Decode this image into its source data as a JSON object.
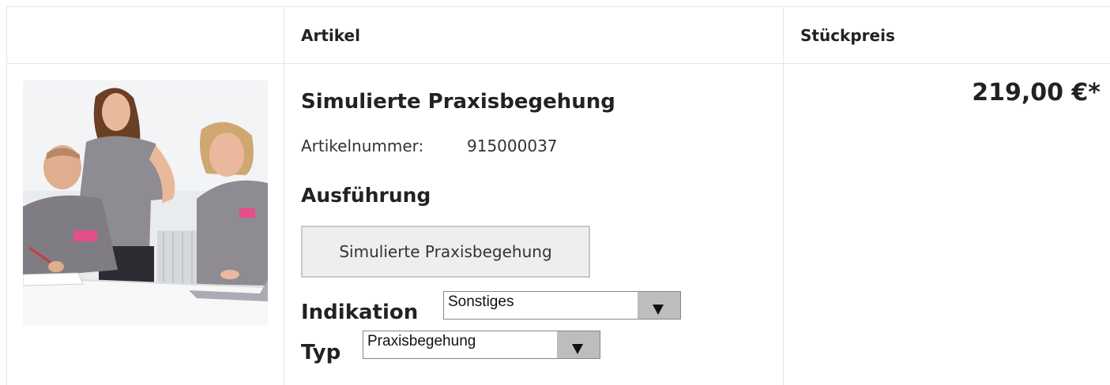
{
  "table": {
    "headers": {
      "artikel": "Artikel",
      "stueckpreis": "Stückpreis"
    }
  },
  "product": {
    "image_icon": "product-photo",
    "title": "Simulierte Praxisbegehung",
    "artikelnummer_label": "Artikelnummer:",
    "artikelnummer_value": "915000037",
    "ausfuehrung_heading": "Ausführung",
    "ausfuehrung_option": "Simulierte Praxisbegehung",
    "indikation_label": "Indikation",
    "indikation_selected": "Sonstiges",
    "typ_label": "Typ",
    "typ_selected": "Praxisbegehung",
    "price": "219,00 €*"
  },
  "colors": {
    "border": "#e6e6e6",
    "button_bg": "#eeeeee",
    "select_arrow_bg": "#bdbdbd"
  }
}
